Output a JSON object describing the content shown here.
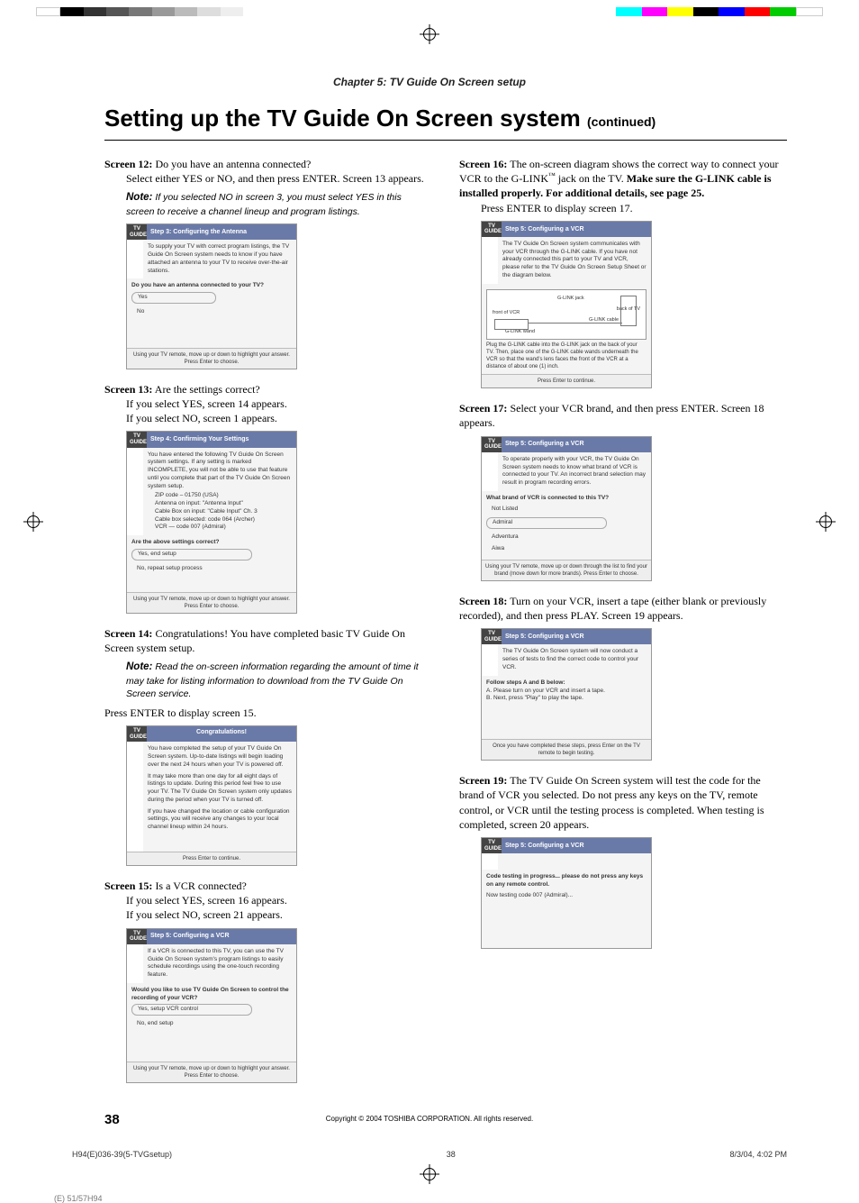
{
  "chapter": "Chapter 5: TV Guide On Screen setup",
  "page_title_main": "Setting up the TV Guide On Screen system",
  "page_title_cont": "(continued)",
  "left": {
    "s12": {
      "label": "Screen 12:",
      "q": "Do you have an antenna connected?",
      "body": "Select either YES or NO, and then press ENTER. Screen 13 appears.",
      "note": "If you selected NO in screen 3, you must select YES in this screen to receive a channel lineup and program listings.",
      "ss": {
        "title": "Step 3: Configuring the Antenna",
        "intro": "To supply your TV with correct program listings, the TV Guide On Screen system needs to know if you have attached an antenna to your TV to receive over-the-air stations.",
        "q": "Do you have an antenna connected to your TV?",
        "opts": [
          "Yes",
          "No"
        ],
        "bottom": "Using your TV remote, move up or down to highlight your answer. Press Enter to choose."
      }
    },
    "s13": {
      "label": "Screen 13:",
      "q": "Are the settings correct?",
      "b1": "If you select YES, screen 14 appears.",
      "b2": "If you select NO, screen 1 appears.",
      "ss": {
        "title": "Step 4: Confirming Your Settings",
        "intro": "You have entered the following TV Guide On Screen system settings. If any setting is marked INCOMPLETE, you will not be able to use that feature until you complete that part of the TV Guide On Screen system setup.",
        "lines": [
          "ZIP code – 01750 (USA)",
          "Antenna on input: \"Antenna Input\"",
          "Cable Box on input: \"Cable Input\" Ch. 3",
          "Cable box selected: code 064 (Archer)",
          "VCR — code 007 (Admiral)"
        ],
        "q": "Are the above settings correct?",
        "opts": [
          "Yes, end setup",
          "No, repeat setup process"
        ],
        "bottom": "Using your TV remote, move up or down to highlight your answer. Press Enter to choose."
      }
    },
    "s14": {
      "label": "Screen 14:",
      "q": "Congratulations! You have completed basic TV Guide On Screen system setup.",
      "note": "Read the on-screen information regarding the amount of time it may take for listing information to download from the TV Guide On Screen service.",
      "after": "Press ENTER to display screen 15.",
      "ss": {
        "bar": "Congratulations!",
        "p1": "You have completed the setup of your TV Guide On Screen system. Up-to-date listings will begin loading over the next 24 hours when your TV is powered off.",
        "p2": "It may take more than one day for all eight days of listings to update. During this period feel free to use your TV. The TV Guide On Screen system only updates during the period when your TV is turned off.",
        "p3": "If you have changed the location or cable configuration settings, you will receive any changes to your local channel lineup within 24 hours.",
        "bottom": "Press Enter to continue."
      }
    },
    "s15": {
      "label": "Screen 15:",
      "q": "Is a VCR connected?",
      "b1": "If you select YES, screen 16 appears.",
      "b2": "If you select NO, screen 21 appears.",
      "ss": {
        "title": "Step 5: Configuring a VCR",
        "intro": "If a VCR is connected to this TV, you can use the TV Guide On Screen system's program listings to easily schedule recordings using the one-touch recording feature.",
        "q": "Would you like to use TV Guide On Screen to control the recording of your VCR?",
        "opts": [
          "Yes, setup VCR control",
          "No, end setup"
        ],
        "bottom": "Using your TV remote, move up or down to highlight your answer. Press Enter to choose."
      }
    }
  },
  "right": {
    "s16": {
      "label": "Screen 16:",
      "body_a": "The on-screen diagram shows the correct way to connect your VCR to the G-LINK",
      "body_b": "jack on the TV.",
      "bold": "Make sure the G-LINK cable is installed properly. For additional details, see page 25.",
      "after": "Press ENTER to display screen 17.",
      "ss": {
        "title": "Step 5: Configuring a VCR",
        "intro": "The TV Guide On Screen system communicates with your VCR through the G-LINK cable. If you have not already connected this part to your TV and VCR, please refer to the TV Guide On Screen Setup Sheet or the diagram below.",
        "labels": {
          "front": "front of VCR",
          "jack": "G-LINK jack",
          "back": "back of TV",
          "cable": "G-LINK cable",
          "wand": "G-LINK wand"
        },
        "plug": "Plug the G-LINK cable into the G-LINK jack on the back of your TV. Then, place one of the G-LINK cable wands underneath the VCR so that the wand's lens faces the front of the VCR at a distance of about one (1) inch.",
        "bottom": "Press Enter to continue."
      }
    },
    "s17": {
      "label": "Screen 17:",
      "body": "Select your VCR brand, and then press ENTER. Screen 18 appears.",
      "ss": {
        "title": "Step 5: Configuring a VCR",
        "intro": "To operate properly with your VCR, the TV Guide On Screen system needs to know what brand of VCR is connected to your TV. An incorrect brand selection may result in program recording errors.",
        "q": "What brand of VCR is connected to this TV?",
        "opts": [
          "Not Listed",
          "Admiral",
          "Adventura",
          "Aiwa"
        ],
        "bottom": "Using your TV remote, move up or down through the list to find your brand (move down for more brands). Press Enter to choose."
      }
    },
    "s18": {
      "label": "Screen 18:",
      "body": "Turn on your VCR, insert a tape (either blank or previously recorded), and then press PLAY. Screen 19 appears.",
      "ss": {
        "title": "Step 5: Configuring a VCR",
        "intro": "The TV Guide On Screen system will now conduct a series of tests to find the correct code to control your VCR.",
        "q": "Follow steps A and B below:",
        "a": "A.   Please turn on your VCR and insert a tape.",
        "b": "B.   Next, press \"Play\" to play the tape.",
        "bottom": "Once you have completed these steps, press Enter on the TV remote to begin testing."
      }
    },
    "s19": {
      "label": "Screen 19:",
      "body": "The TV Guide On Screen system will test the code for the brand of VCR you selected. Do not press any keys on the TV, remote control, or VCR until the testing process is completed. When testing is completed, screen 20 appears.",
      "ss": {
        "title": "Step 5: Configuring a VCR",
        "l1": "Code testing in progress... please do not press any keys on any remote control.",
        "l2": "Now testing code 007 (Admiral)..."
      }
    }
  },
  "note_word": "Note:",
  "guide_word": "TV GUIDE",
  "page_number": "38",
  "copyright": "Copyright © 2004 TOSHIBA CORPORATION. All rights reserved.",
  "footer": {
    "left": "H94(E)036-39(5-TVGsetup)",
    "mid": "38",
    "right": "8/3/04, 4:02 PM"
  },
  "cutline": "(E) 51/57H94"
}
